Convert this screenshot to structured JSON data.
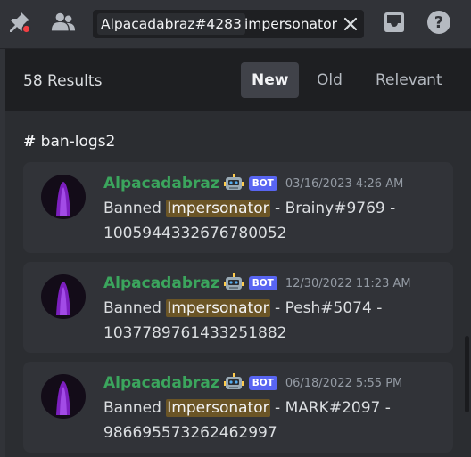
{
  "search": {
    "filter_value": "Alpacadabraz#4283",
    "query": "impersonator"
  },
  "results": {
    "count_label": "58 Results",
    "sort_options": [
      {
        "label": "New",
        "active": true
      },
      {
        "label": "Old",
        "active": false
      },
      {
        "label": "Relevant",
        "active": false
      }
    ]
  },
  "channel": {
    "hash": "#",
    "name": "ban-logs2"
  },
  "messages": [
    {
      "author": "Alpacadabraz",
      "bot_tag": "BOT",
      "timestamp": "03/16/2023 4:26 AM",
      "prefix": "Banned ",
      "highlight": "Impersonator",
      "line1_rest": " - Brainy#9769 -",
      "line2": "1005944332676780052"
    },
    {
      "author": "Alpacadabraz",
      "bot_tag": "BOT",
      "timestamp": "12/30/2022 11:23 AM",
      "prefix": "Banned ",
      "highlight": "Impersonator",
      "line1_rest": " - Pesh#5074 -",
      "line2": "1037789761433251882"
    },
    {
      "author": "Alpacadabraz",
      "bot_tag": "BOT",
      "timestamp": "06/18/2022 5:55 PM",
      "prefix": "Banned ",
      "highlight": "Impersonator",
      "line1_rest": " - MARK#2097 -",
      "line2": "986695573262462997"
    }
  ],
  "colors": {
    "author_green": "#3ba55d",
    "bot_blurple": "#5865f2",
    "highlight": "#6b5526",
    "background": "#313338"
  },
  "icons": [
    "pin-icon",
    "members-icon",
    "close-icon",
    "inbox-icon",
    "help-icon",
    "robot-emoji-icon"
  ]
}
